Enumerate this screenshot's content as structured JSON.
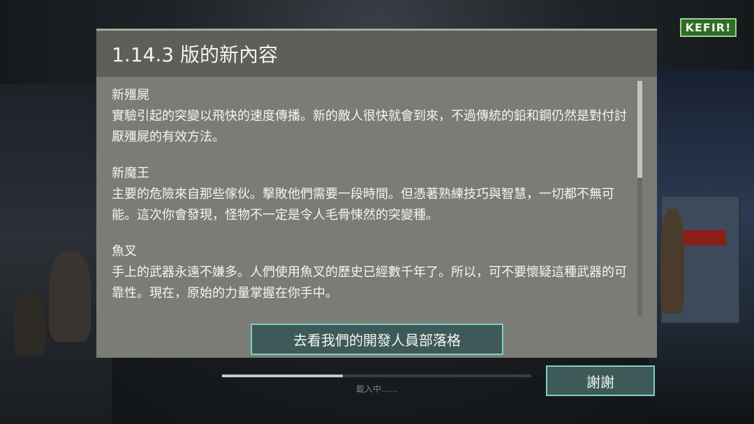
{
  "logo": {
    "text": "KEFIR!"
  },
  "dialog": {
    "title": "1.14.3 版的新內容",
    "sections": [
      {
        "title": "新殭屍",
        "body": "實驗引起的突變以飛快的速度傳播。新的敵人很快就會到來，不過傳統的鉛和鋼仍然是對付討厭殭屍的有效方法。"
      },
      {
        "title": "新魔王",
        "body": "主要的危險來自那些傢伙。擊敗他們需要一段時間。但憑著熟練技巧與智慧，一切都不無可能。這次你會發現，怪物不一定是令人毛骨悚然的突變種。"
      },
      {
        "title": "魚叉",
        "body": "手上的武器永遠不嫌多。人們使用魚叉的歷史已經數千年了。所以，可不要懷疑這種武器的可靠性。現在，原始的力量掌握在你手中。"
      }
    ],
    "devblog_button": "去看我們的開發人員部落格",
    "scroll_position": 0.0,
    "scroll_visible_fraction": 0.41
  },
  "loading": {
    "text": "載入中……",
    "progress": 0.39
  },
  "thanks_button": "謝謝",
  "colors": {
    "accent": "#7fd0c6",
    "dialog_bg": "#7b7c76",
    "title_bg": "#5e5f5a",
    "logo_bg": "#2f6b2a"
  }
}
